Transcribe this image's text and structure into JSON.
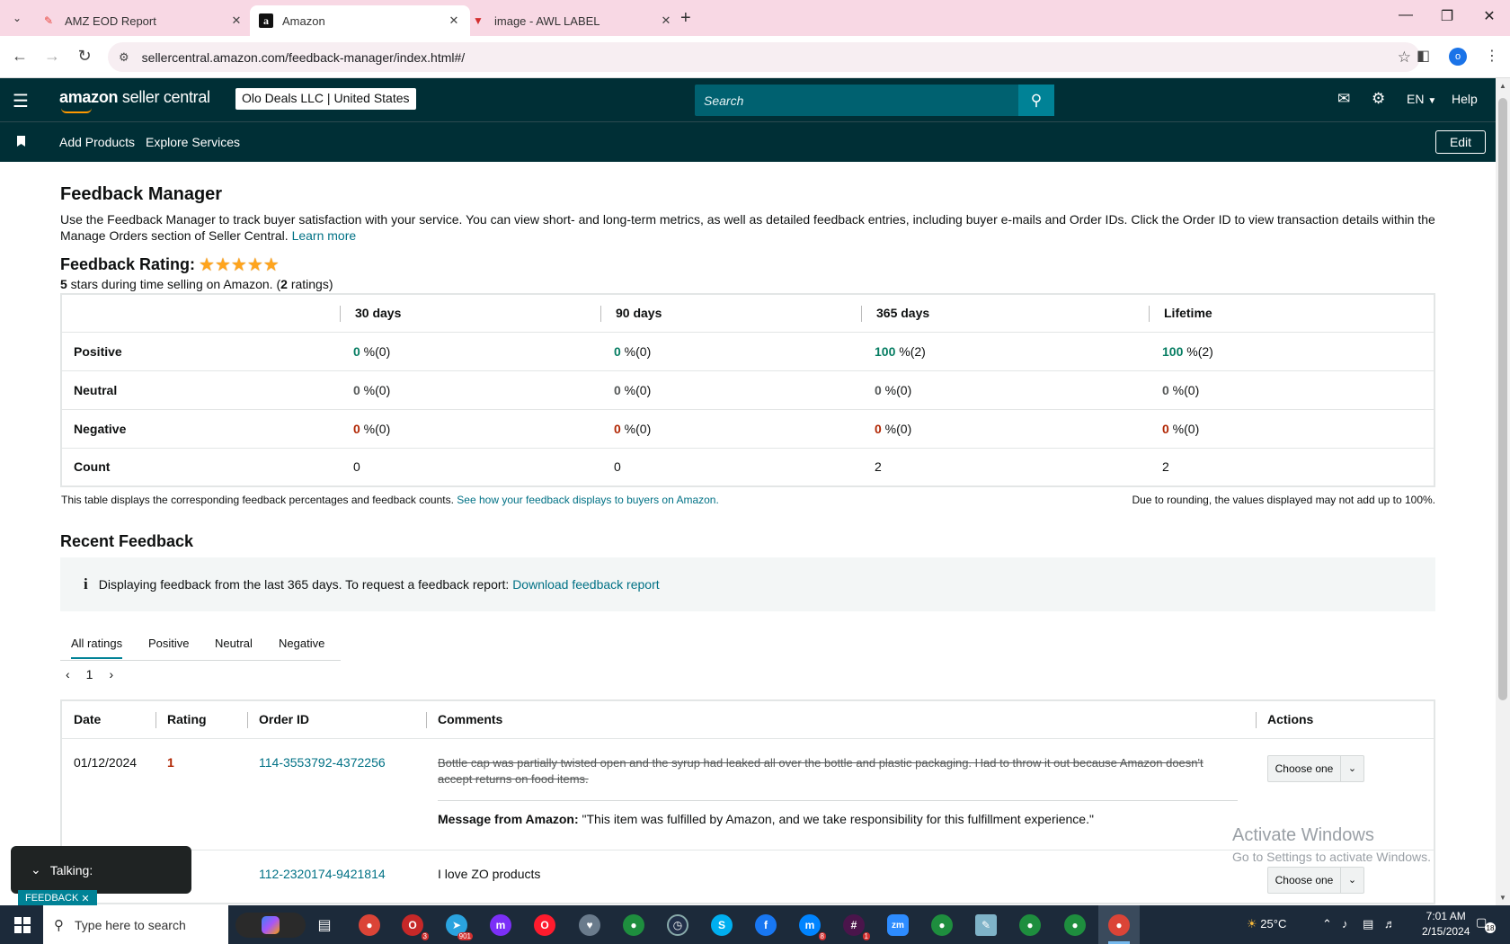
{
  "browser": {
    "tabs": [
      {
        "title": "AMZ EOD Report",
        "favicon": "pencil-icon",
        "active": false
      },
      {
        "title": "Amazon",
        "favicon": "amazon-icon",
        "active": true
      },
      {
        "title": "image - AWL LABEL",
        "favicon": "awl-icon",
        "active": false
      }
    ],
    "url": "sellercentral.amazon.com/feedback-manager/index.html#/",
    "profile_initial": "o"
  },
  "header": {
    "logo_text_1": "amazon",
    "logo_text_2": " seller central",
    "account": "Olo Deals LLC | United States",
    "search_placeholder": "Search",
    "language": "EN",
    "help": "Help"
  },
  "subnav": {
    "items": [
      "Add Products",
      "Explore Services"
    ],
    "edit": "Edit"
  },
  "page": {
    "title": "Feedback Manager",
    "intro": "Use the Feedback Manager to track buyer satisfaction with your service. You can view short- and long-term metrics, as well as detailed feedback entries, including buyer e-mails and Order IDs. Click the Order ID to view transaction details within the Manage Orders section of Seller Central.",
    "learn_more": "Learn more",
    "rating_label": "Feedback Rating:",
    "stars": 5,
    "rating_sub_stars": "5",
    "rating_sub_mid": " stars during time selling on Amazon. (",
    "rating_sub_count": "2",
    "rating_sub_end": " ratings)"
  },
  "metrics": {
    "columns": [
      "30 days",
      "90 days",
      "365 days",
      "Lifetime"
    ],
    "rows": [
      {
        "label": "Positive",
        "values": [
          [
            "0",
            " %(0)"
          ],
          [
            "0",
            " %(0)"
          ],
          [
            "100",
            " %(2)"
          ],
          [
            "100",
            " %(2)"
          ]
        ]
      },
      {
        "label": "Neutral",
        "values": [
          [
            "0",
            " %(0)"
          ],
          [
            "0",
            " %(0)"
          ],
          [
            "0",
            " %(0)"
          ],
          [
            "0",
            " %(0)"
          ]
        ]
      },
      {
        "label": "Negative",
        "values": [
          [
            "0",
            " %(0)"
          ],
          [
            "0",
            " %(0)"
          ],
          [
            "0",
            " %(0)"
          ],
          [
            "0",
            " %(0)"
          ]
        ]
      },
      {
        "label": "Count",
        "values": [
          [
            "0",
            ""
          ],
          [
            "0",
            ""
          ],
          [
            "2",
            ""
          ],
          [
            "2",
            ""
          ]
        ]
      }
    ],
    "note_left": "This table displays the corresponding feedback percentages and feedback counts.",
    "note_left_link": "See how your feedback displays to buyers on Amazon.",
    "note_right": "Due to rounding, the values displayed may not add up to 100%."
  },
  "recent": {
    "title": "Recent Feedback",
    "info": "Displaying feedback from the last 365 days. To request a feedback report:",
    "info_link": "Download feedback report",
    "tabs": [
      "All ratings",
      "Positive",
      "Neutral",
      "Negative"
    ],
    "page": "1",
    "columns": [
      "Date",
      "Rating",
      "Order ID",
      "Comments",
      "Actions"
    ],
    "rows": [
      {
        "date": "01/12/2024",
        "rating": "1",
        "order_id": "114-3553792-4372256",
        "comment": "Bottle cap was partially twisted open and the syrup had leaked all over the bottle and plastic packaging. Had to throw it out because Amazon doesn't accept returns on food items.",
        "amazon_label": "Message from Amazon:",
        "amazon_msg": " \"This item was fulfilled by Amazon, and we take responsibility for this fulfillment experience.\"",
        "action": "Choose one"
      },
      {
        "date": "",
        "rating": "",
        "order_id": "112-2320174-9421814",
        "comment": "I love ZO products",
        "action": "Choose one"
      }
    ]
  },
  "overlay": {
    "activate_1": "Activate Windows",
    "activate_2": "Go to Settings to activate Windows.",
    "talking": "Talking:",
    "feedback_tag": "FEEDBACK"
  },
  "taskbar": {
    "search_placeholder": "Type here to search",
    "weather": "25°C",
    "time": "7:01 AM",
    "date": "2/15/2024",
    "notifications": "18",
    "badges": {
      "opera_gx": "3",
      "telegram": "901",
      "messenger": "8",
      "slack": "1"
    }
  }
}
